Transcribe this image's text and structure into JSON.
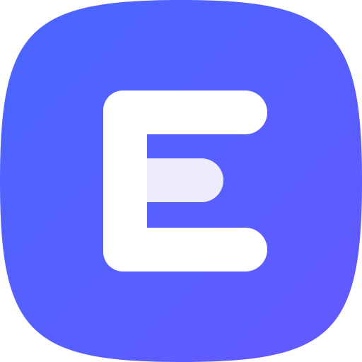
{
  "icon": {
    "name": "e-app-icon",
    "letter": "E",
    "colors": {
      "gradient_start": "#4a66ff",
      "gradient_end": "#6358ff",
      "letter_fill": "#ffffff",
      "middle_bar_fill": "#ececfb"
    }
  }
}
